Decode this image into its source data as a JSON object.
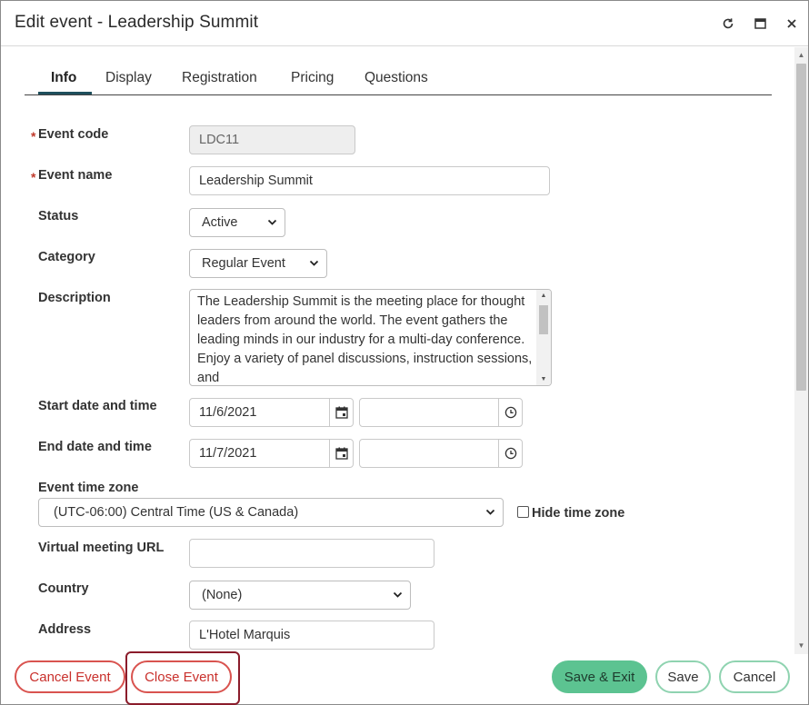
{
  "window": {
    "title": "Edit event - Leadership Summit",
    "controls": {
      "refresh": "refresh-icon",
      "maximize": "maximize-icon",
      "close": "close-icon"
    }
  },
  "tabs": [
    {
      "label": "Info",
      "active": true
    },
    {
      "label": "Display",
      "active": false
    },
    {
      "label": "Registration",
      "active": false
    },
    {
      "label": "Pricing",
      "active": false
    },
    {
      "label": "Questions",
      "active": false
    }
  ],
  "form": {
    "required_marker": "*",
    "event_code": {
      "label": "Event code",
      "value": "LDC11",
      "required": true,
      "disabled": true
    },
    "event_name": {
      "label": "Event name",
      "value": "Leadership Summit",
      "required": true
    },
    "status": {
      "label": "Status",
      "value": "Active"
    },
    "category": {
      "label": "Category",
      "value": "Regular Event"
    },
    "description": {
      "label": "Description",
      "value": "The Leadership Summit is the meeting place for thought leaders from around the world. The event gathers the leading minds in our industry for a multi-day conference. Enjoy a variety of panel discussions, instruction sessions, and"
    },
    "start": {
      "label": "Start date and time",
      "date": "11/6/2021",
      "time": ""
    },
    "end": {
      "label": "End date and time",
      "date": "11/7/2021",
      "time": ""
    },
    "time_zone": {
      "label": "Event time zone",
      "value": "(UTC-06:00) Central Time (US & Canada)"
    },
    "hide_time_zone": {
      "label": "Hide time zone",
      "checked": false
    },
    "virtual_url": {
      "label": "Virtual meeting URL",
      "value": ""
    },
    "country": {
      "label": "Country",
      "value": "(None)"
    },
    "address": {
      "label": "Address",
      "value": "L'Hotel Marquis"
    }
  },
  "footer": {
    "cancel_event": "Cancel Event",
    "close_event": "Close Event",
    "save_exit": "Save & Exit",
    "save": "Save",
    "cancel": "Cancel"
  },
  "colors": {
    "accent": "#1e4f5c",
    "danger": "#d9534f",
    "primary": "#5cc391",
    "required": "#c0392b",
    "highlight": "#8b1c2b"
  }
}
